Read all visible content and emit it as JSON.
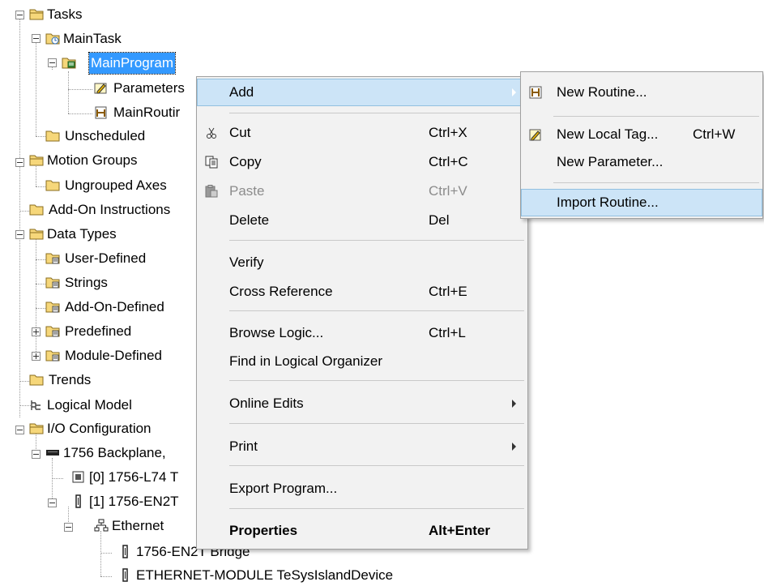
{
  "tree": {
    "tasks": "Tasks",
    "main_task": "MainTask",
    "main_program": "MainProgram",
    "parameters": "Parameters",
    "main_routine": "MainRoutir",
    "unscheduled": "Unscheduled",
    "motion_groups": "Motion Groups",
    "ungrouped_axes": "Ungrouped Axes",
    "add_on_instructions": "Add-On Instructions",
    "data_types": "Data Types",
    "user_defined": "User-Defined",
    "strings": "Strings",
    "add_on_defined": "Add-On-Defined",
    "predefined": "Predefined",
    "module_defined": "Module-Defined",
    "trends": "Trends",
    "logical_model": "Logical Model",
    "io_configuration": "I/O Configuration",
    "backplane": "1756 Backplane,",
    "slot0": "[0] 1756-L74 T",
    "slot1": "[1] 1756-EN2T",
    "ethernet": "Ethernet",
    "bridge": "1756-EN2T Bridge",
    "ethernet_module": "ETHERNET-MODULE TeSysIslandDevice"
  },
  "context_menu": {
    "add": "Add",
    "cut": "Cut",
    "cut_sc": "Ctrl+X",
    "copy": "Copy",
    "copy_sc": "Ctrl+C",
    "paste": "Paste",
    "paste_sc": "Ctrl+V",
    "delete": "Delete",
    "delete_sc": "Del",
    "verify": "Verify",
    "cross_reference": "Cross Reference",
    "cross_reference_sc": "Ctrl+E",
    "browse_logic": "Browse Logic...",
    "browse_logic_sc": "Ctrl+L",
    "find_logical": "Find in Logical Organizer",
    "online_edits": "Online Edits",
    "print": "Print",
    "export_program": "Export Program...",
    "properties": "Properties",
    "properties_sc": "Alt+Enter"
  },
  "submenu": {
    "new_routine": "New Routine...",
    "new_local_tag": "New Local Tag...",
    "new_local_tag_sc": "Ctrl+W",
    "new_parameter": "New Parameter...",
    "import_routine": "Import Routine..."
  },
  "colors": {
    "selection": "#3399ff",
    "menu_highlight": "#cce4f7",
    "menu_bg": "#f2f2f2",
    "folder": "#f6d77a"
  }
}
